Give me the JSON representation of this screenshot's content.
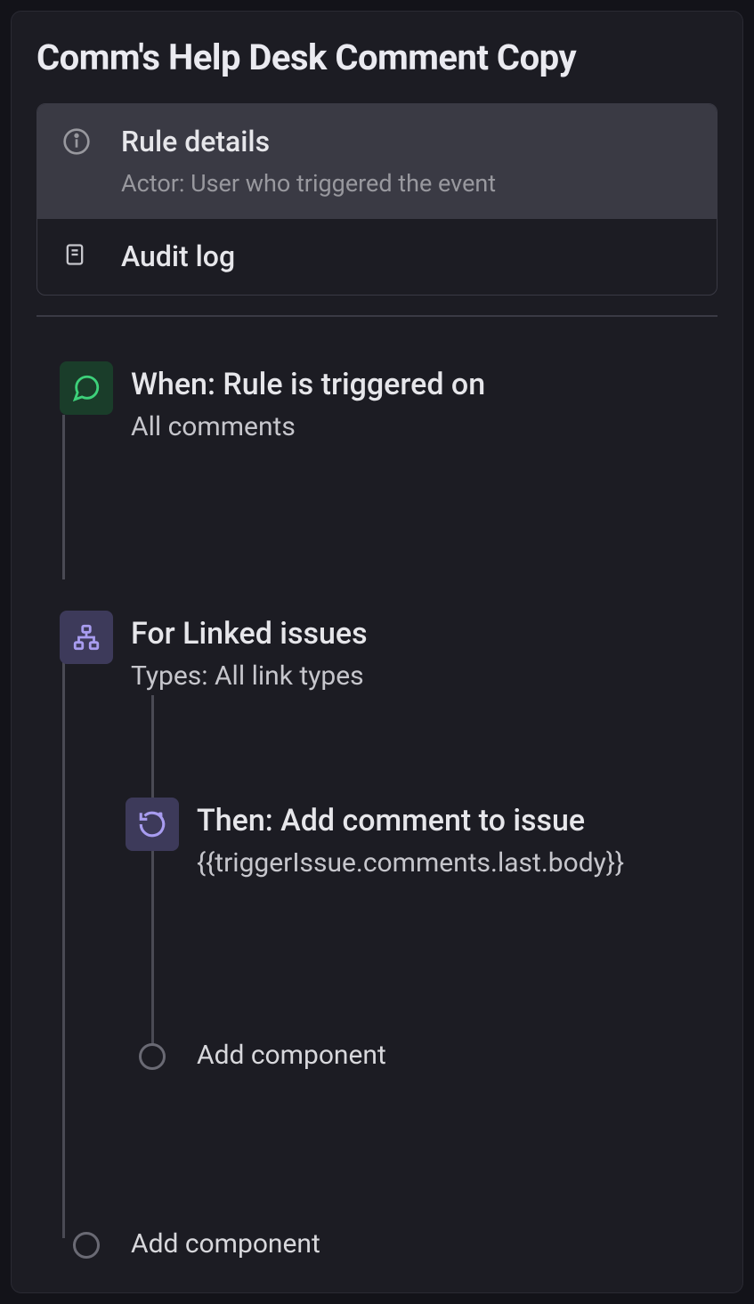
{
  "title": "Comm's Help Desk Comment Copy",
  "ruleDetails": {
    "title": "Rule details",
    "subtitle": "Actor: User who triggered the event"
  },
  "auditLog": {
    "title": "Audit log"
  },
  "trigger": {
    "title": "When: Rule is triggered on",
    "subtitle": "All comments"
  },
  "branch": {
    "title": "For Linked issues",
    "subtitle": "Types: All link types"
  },
  "action": {
    "title": "Then: Add comment to issue",
    "subtitle": "{{triggerIssue.comments.last.body}}"
  },
  "addComponent": "Add component"
}
